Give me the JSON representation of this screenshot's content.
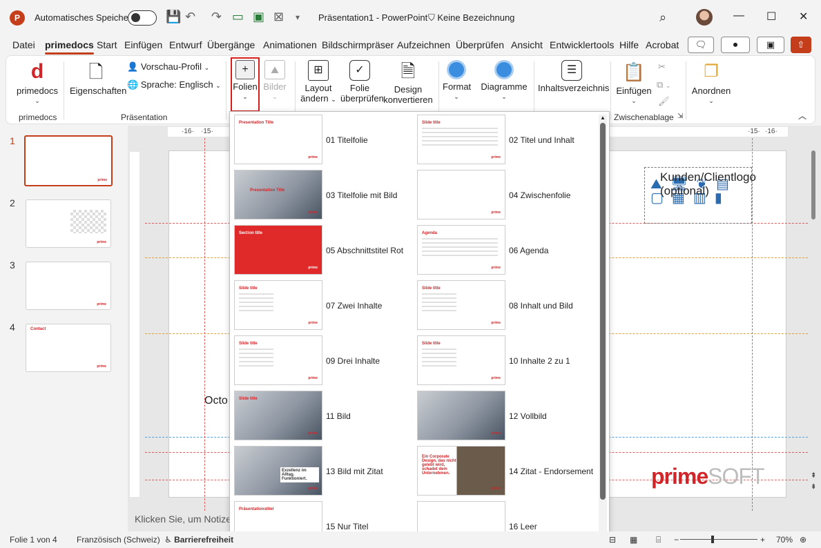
{
  "titlebar": {
    "app_letter": "P",
    "autosave_label": "Automatisches Speichern",
    "doc_title": "Präsentation1  -  PowerPoint",
    "sensitivity": "Keine Bezeichnung"
  },
  "tabs": [
    "Datei",
    "primedocs",
    "Start",
    "Einfügen",
    "Entwurf",
    "Übergänge",
    "Animationen",
    "Bildschirmpräser",
    "Aufzeichnen",
    "Überprüfen",
    "Ansicht",
    "Entwicklertools",
    "Hilfe",
    "Acrobat"
  ],
  "ribbon": {
    "primedocs_btn": "primedocs",
    "primedocs_group": "primedocs",
    "eigenschaften": "Eigenschaften",
    "vorschau": "Vorschau-Profil",
    "sprache": "Sprache: Englisch",
    "praesentation_group": "Präsentation",
    "folien": "Folien",
    "bilder": "Bilder",
    "layout1": "Layout",
    "layout2": "ändern",
    "folie1": "Folie",
    "folie2": "überprüfen",
    "design1": "Design",
    "design2": "konvertieren",
    "format": "Format",
    "diagramme": "Diagramme",
    "inhalt": "Inhaltsverzeichnis",
    "einfuegen": "Einfügen",
    "zwischenablage": "Zwischenablage",
    "anordnen": "Anordnen"
  },
  "slides": [
    {
      "num": "1"
    },
    {
      "num": "2"
    },
    {
      "num": "3"
    },
    {
      "num": "4"
    }
  ],
  "thumb_texts": {
    "brand": "prime",
    "slide4_title": "Contact"
  },
  "gallery": [
    {
      "name": "01 Titelfolie",
      "title": "Presentation Title"
    },
    {
      "name": "02 Titel und Inhalt",
      "title": "Slide title"
    },
    {
      "name": "03 Titelfolie mit Bild",
      "title": "Presentation Title"
    },
    {
      "name": "04 Zwischenfolie",
      "title": ""
    },
    {
      "name": "05 Abschnittstitel Rot",
      "title": "Section title"
    },
    {
      "name": "06 Agenda",
      "title": "Agenda"
    },
    {
      "name": "07 Zwei Inhalte",
      "title": "Slide title"
    },
    {
      "name": "08 Inhalt und Bild",
      "title": "Slide title"
    },
    {
      "name": "09 Drei Inhalte",
      "title": "Slide title"
    },
    {
      "name": "10 Inhalte 2 zu 1",
      "title": "Slide title"
    },
    {
      "name": "11 Bild",
      "title": "Slide title"
    },
    {
      "name": "12 Vollbild",
      "title": ""
    },
    {
      "name": "13 Bild mit Zitat",
      "title": "Exzellenz im Alltag. Funktioniert."
    },
    {
      "name": "14 Zitat - Endorsement",
      "title": "Ein Corporate Design, das nicht gelebt wird, schadet dem Unternehmen."
    },
    {
      "name": "15 Nur Titel",
      "title": "Präsentationstitel"
    },
    {
      "name": "16 Leer",
      "title": ""
    }
  ],
  "slide": {
    "client_logo": "Kunden/Clientlogo (optional)",
    "date_text": "Octo",
    "logo_prime": "prime",
    "logo_soft": "SOFT"
  },
  "notes": "Klicken Sie, um Notizen",
  "statusbar": {
    "slide_count": "Folie 1 von 4",
    "language": "Französisch (Schweiz)",
    "accessibility": "Barrierefreiheit",
    "zoom": "70%"
  },
  "colors": {
    "accent": "#c43e1c",
    "brand_red": "#d0262a",
    "highlight": "#d81d1d"
  }
}
